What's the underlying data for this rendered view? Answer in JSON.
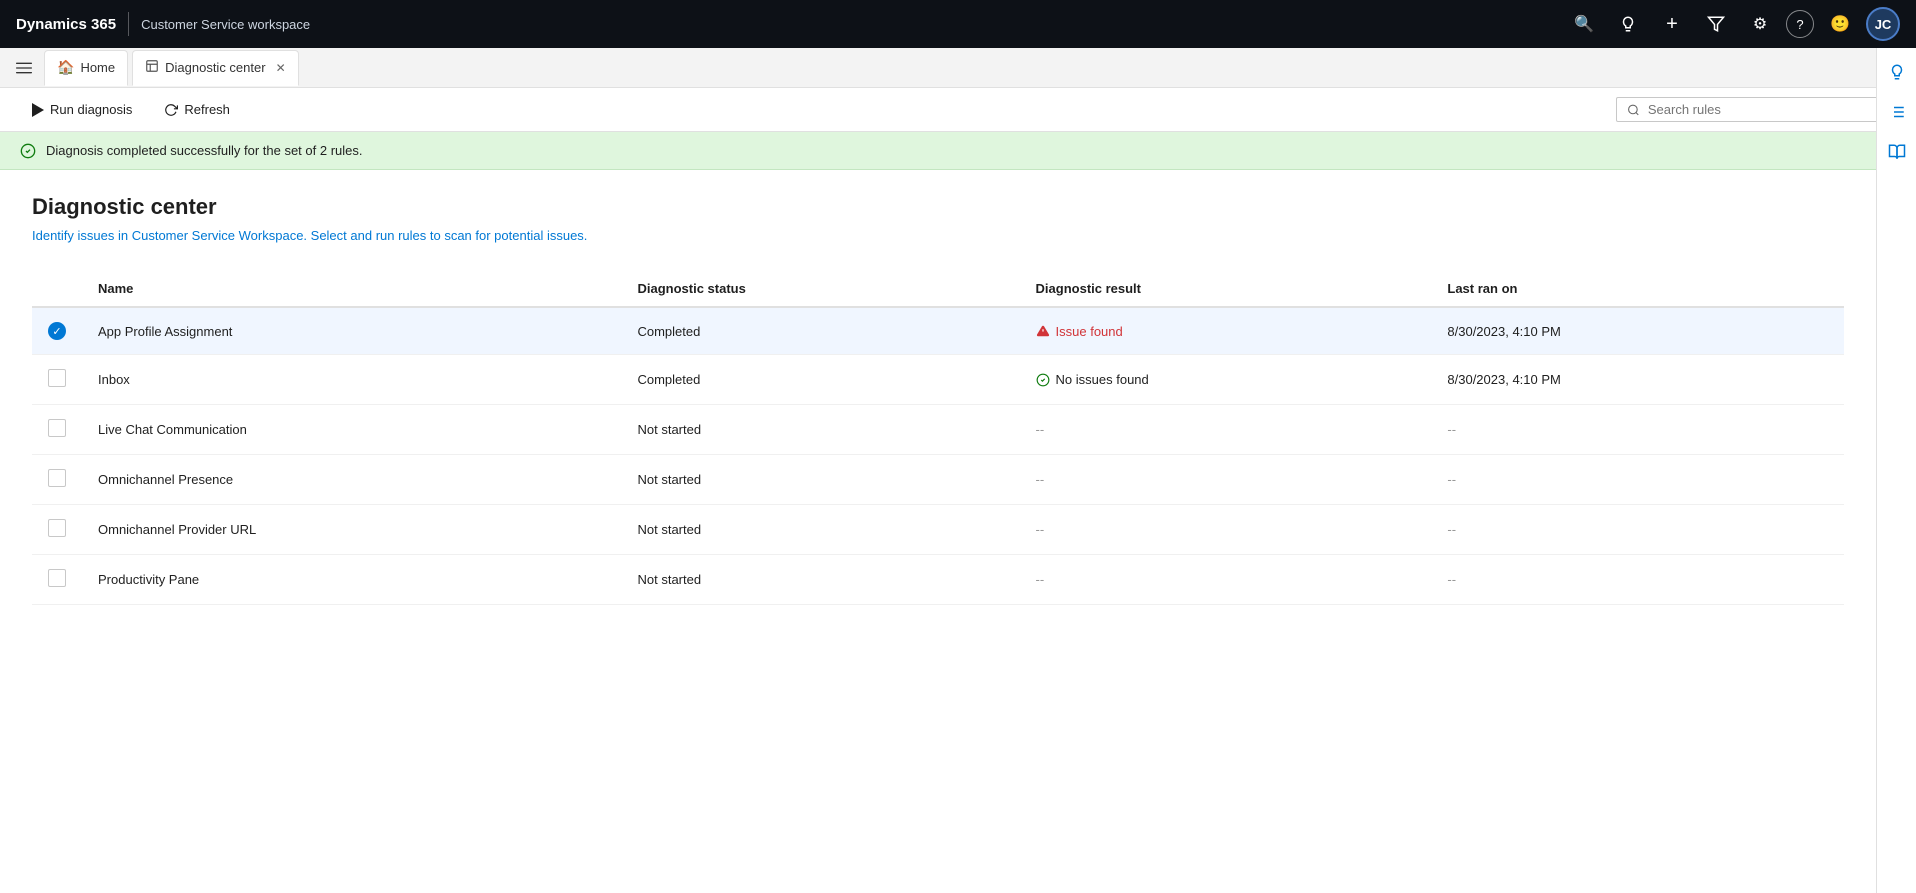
{
  "app": {
    "brand": "Dynamics 365",
    "subtitle": "Customer Service workspace",
    "avatar_initials": "JC"
  },
  "top_nav_icons": [
    {
      "name": "search-icon",
      "symbol": "🔍"
    },
    {
      "name": "lightbulb-icon",
      "symbol": "💡"
    },
    {
      "name": "add-icon",
      "symbol": "+"
    },
    {
      "name": "filter-icon",
      "symbol": "⊽"
    },
    {
      "name": "settings-icon",
      "symbol": "⚙"
    },
    {
      "name": "help-icon",
      "symbol": "?"
    },
    {
      "name": "feedback-icon",
      "symbol": "😊"
    }
  ],
  "tabs": [
    {
      "id": "home",
      "label": "Home",
      "icon": "🏠",
      "active": false,
      "closable": false
    },
    {
      "id": "diagnostic",
      "label": "Diagnostic center",
      "icon": "📋",
      "active": true,
      "closable": true
    }
  ],
  "right_sidebar_icons": [
    {
      "name": "bulb-icon",
      "symbol": "💡"
    },
    {
      "name": "list-icon",
      "symbol": "≡"
    },
    {
      "name": "book-icon",
      "symbol": "📖"
    }
  ],
  "toolbar": {
    "run_diagnosis_label": "Run diagnosis",
    "refresh_label": "Refresh",
    "search_placeholder": "Search rules"
  },
  "banner": {
    "message": "Diagnosis completed successfully for the set of 2 rules."
  },
  "page": {
    "title": "Diagnostic center",
    "description": "Identify issues in Customer Service Workspace. Select and run rules to scan for potential issues."
  },
  "table": {
    "columns": [
      "Name",
      "Diagnostic status",
      "Diagnostic result",
      "Last ran on"
    ],
    "rows": [
      {
        "id": 1,
        "checked": true,
        "name": "App Profile Assignment",
        "status": "Completed",
        "result_type": "issue",
        "result_text": "Issue found",
        "last_ran": "8/30/2023, 4:10 PM"
      },
      {
        "id": 2,
        "checked": false,
        "name": "Inbox",
        "status": "Completed",
        "result_type": "ok",
        "result_text": "No issues found",
        "last_ran": "8/30/2023, 4:10 PM"
      },
      {
        "id": 3,
        "checked": false,
        "name": "Live Chat Communication",
        "status": "Not started",
        "result_type": "dash",
        "result_text": "--",
        "last_ran": "--"
      },
      {
        "id": 4,
        "checked": false,
        "name": "Omnichannel Presence",
        "status": "Not started",
        "result_type": "dash",
        "result_text": "--",
        "last_ran": "--"
      },
      {
        "id": 5,
        "checked": false,
        "name": "Omnichannel Provider URL",
        "status": "Not started",
        "result_type": "dash",
        "result_text": "--",
        "last_ran": "--"
      },
      {
        "id": 6,
        "checked": false,
        "name": "Productivity Pane",
        "status": "Not started",
        "result_type": "dash",
        "result_text": "--",
        "last_ran": "--"
      }
    ]
  }
}
